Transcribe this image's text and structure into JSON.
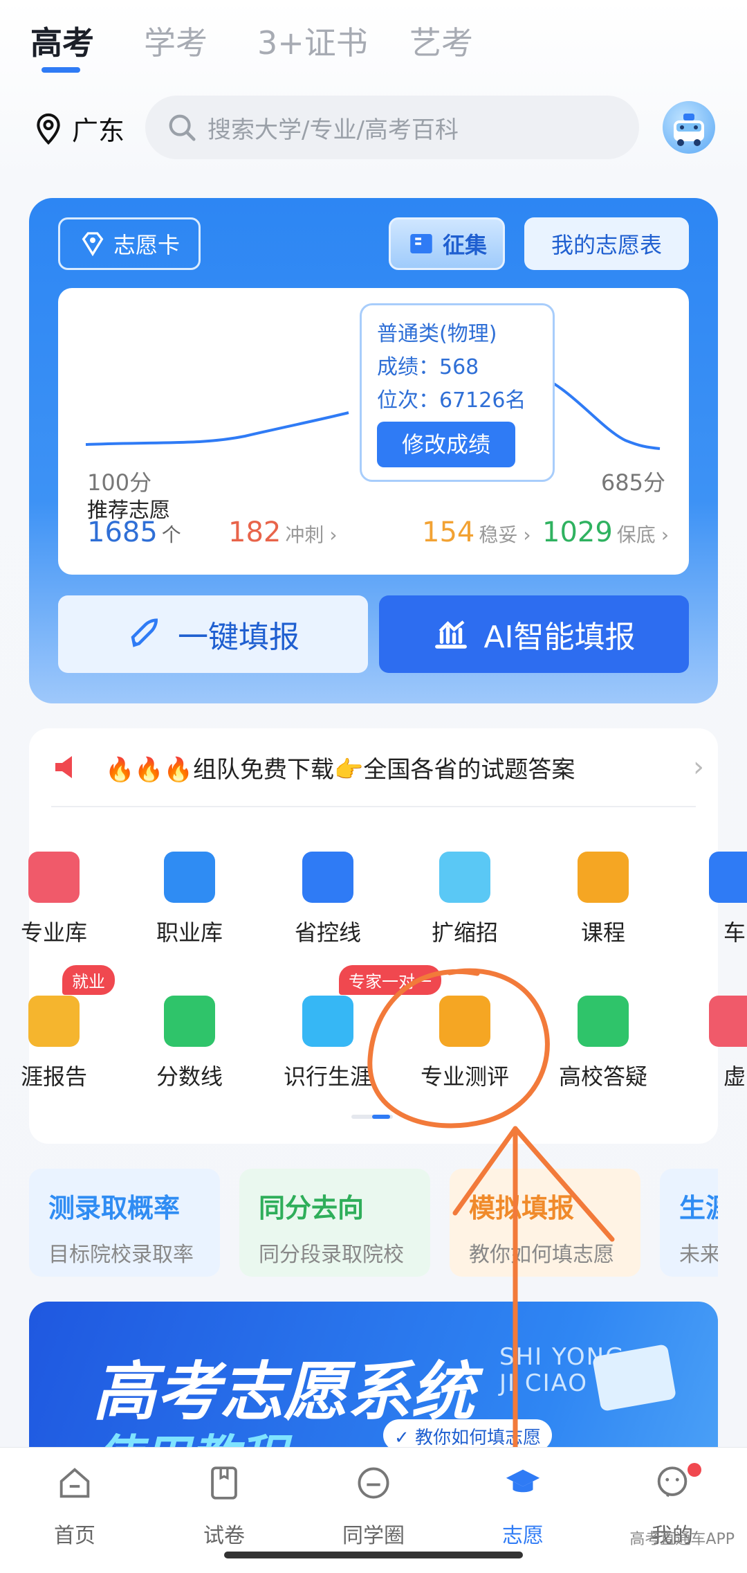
{
  "top_tabs": [
    {
      "label": "高考",
      "active": true
    },
    {
      "label": "学考",
      "active": false
    },
    {
      "label": "3+证书",
      "active": false
    },
    {
      "label": "艺考",
      "active": false
    }
  ],
  "location": "广东",
  "search": {
    "placeholder": "搜索大学/专业/高考百科"
  },
  "hero": {
    "card_label": "志愿卡",
    "collect_label": "征集",
    "my_table_label": "我的志愿表",
    "tooltip": {
      "category": "普通类(物理)",
      "score_label": "成绩：568",
      "rank_label": "位次：67126名",
      "edit_button": "修改成绩"
    },
    "axis_min": "100分",
    "axis_max": "685分",
    "recommend_label": "推荐志愿",
    "total": {
      "value": "1685",
      "unit": "个"
    },
    "stats": [
      {
        "value": "182",
        "label": "冲刺",
        "color": "#e8644a"
      },
      {
        "value": "154",
        "label": "稳妥",
        "color": "#f2a233"
      },
      {
        "value": "1029",
        "label": "保底",
        "color": "#2fb260"
      }
    ],
    "one_click_label": "一键填报",
    "ai_fill_label": "AI智能填报"
  },
  "notice": {
    "text": "🔥🔥🔥组队免费下载👉全国各省的试题答案"
  },
  "grid_row1": [
    {
      "label": "专业库",
      "icon": "book-icon",
      "color": "#f05a6a"
    },
    {
      "label": "职业库",
      "icon": "briefcase-icon",
      "color": "#2f8cf3"
    },
    {
      "label": "省控线",
      "icon": "trend-icon",
      "color": "#2f7bf5"
    },
    {
      "label": "扩缩招",
      "icon": "recruit-icon",
      "color": "#5ac8f5"
    },
    {
      "label": "课程",
      "icon": "play-icon",
      "color": "#f5a623"
    },
    {
      "label": "车",
      "icon": "car-icon",
      "color": "#2f7bf5"
    }
  ],
  "grid_row2": [
    {
      "label": "涯报告",
      "icon": "report-icon",
      "color": "#f5b52e",
      "tag": "就业"
    },
    {
      "label": "分数线",
      "icon": "bar-chart-icon",
      "color": "#2fc46a"
    },
    {
      "label": "识行生涯",
      "icon": "career-icon",
      "color": "#36b7f5",
      "tag": "专家一对一"
    },
    {
      "label": "专业测评",
      "icon": "check-clipboard-icon",
      "color": "#f5a623"
    },
    {
      "label": "高校答疑",
      "icon": "chat-icon",
      "color": "#2fc46a"
    },
    {
      "label": "虚",
      "icon": "vr-icon",
      "color": "#f05a6a"
    }
  ],
  "quick_cards": [
    {
      "title": "测录取概率",
      "sub": "目标院校录取率",
      "color": "#2f8cf3",
      "bg": "#eaf3ff"
    },
    {
      "title": "同分去向",
      "sub": "同分段录取院校",
      "color": "#2fae5a",
      "bg": "#eaf8ef"
    },
    {
      "title": "模拟填报",
      "sub": "教你如何填志愿",
      "color": "#f08a2a",
      "bg": "#fff3e4"
    },
    {
      "title": "生涯",
      "sub": "未来",
      "color": "#2f8cf3",
      "bg": "#eaf3ff"
    }
  ],
  "banner": {
    "title": "高考志愿系统",
    "subtitle": "使用教程",
    "pinyin1": "SHI YONG",
    "pinyin2": "JI CIAO",
    "badge": "教你如何填志愿"
  },
  "bottom_nav": [
    {
      "label": "首页",
      "icon": "home-icon",
      "active": false
    },
    {
      "label": "试卷",
      "icon": "paper-icon",
      "active": false
    },
    {
      "label": "同学圈",
      "icon": "circle-chat-icon",
      "active": false
    },
    {
      "label": "志愿",
      "icon": "graduation-cap-icon",
      "active": true
    },
    {
      "label": "我的",
      "icon": "profile-icon",
      "active": false
    }
  ],
  "watermark": "高考直通车APP",
  "colors": {
    "brand": "#2f7bf5",
    "annotation": "#f27a3a"
  }
}
